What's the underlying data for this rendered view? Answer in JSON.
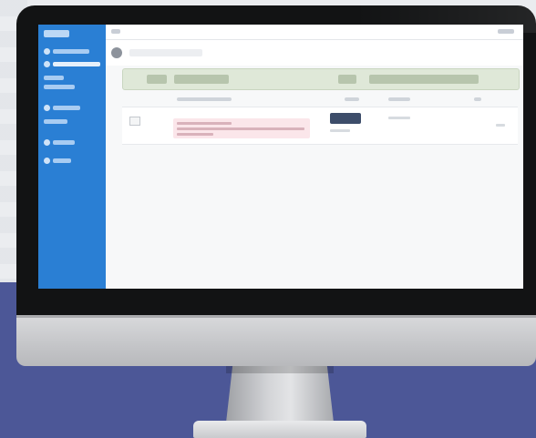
{
  "scene": {
    "colors": {
      "wall": "#eaecef",
      "desk": "#4c5797",
      "bezel": "#121314",
      "sidebar": "#2a7fd4",
      "table_header": "#dfe8d8",
      "row_highlight": "#fbe6ea",
      "status_badge": "#3d4d6a"
    }
  },
  "app": {
    "sidebar": {
      "items": [
        {
          "icon": "dashboard-icon"
        },
        {
          "icon": "list-icon"
        },
        {
          "icon": "users-icon"
        },
        {
          "icon": "settings-icon"
        },
        {
          "icon": "reports-icon"
        }
      ]
    },
    "toolbar": {
      "back_icon": "back-arrow-icon"
    },
    "table": {
      "columns": 4,
      "rows": 1
    }
  }
}
